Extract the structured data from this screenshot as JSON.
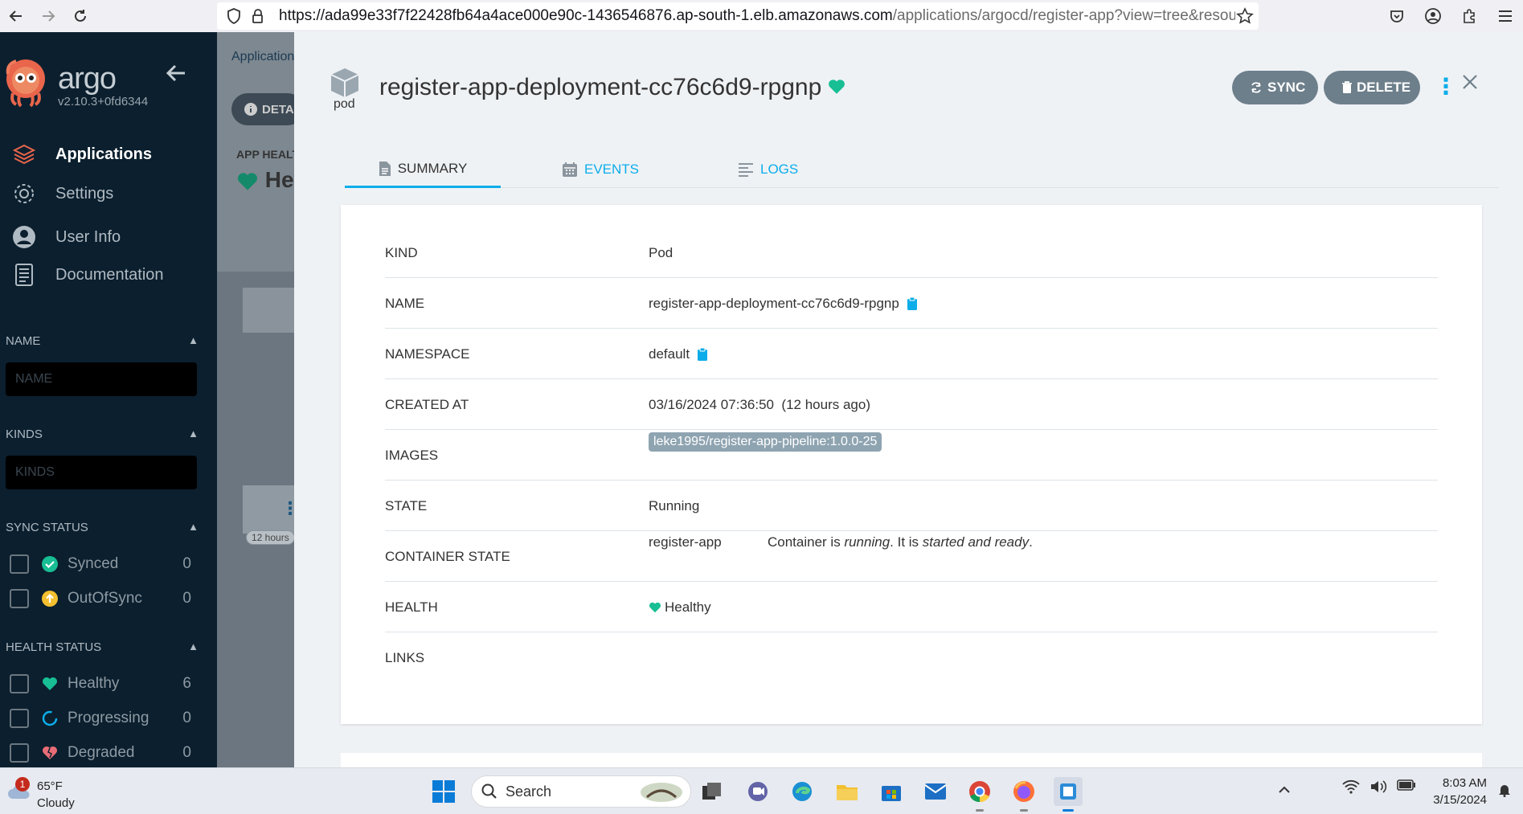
{
  "browser": {
    "url_main": "https://ada99e33f7f22428fb64a4ace000e90c-1436546876.ap-south-1.elb.amazonaws.com",
    "url_path": "/applications/argocd/register-app?view=tree&resource=&condit"
  },
  "sidebar": {
    "logo_name": "argo",
    "version": "v2.10.3+0fd6344",
    "nav": [
      {
        "label": "Applications",
        "icon": "layers-icon"
      },
      {
        "label": "Settings",
        "icon": "gear-icon"
      },
      {
        "label": "User Info",
        "icon": "user-icon"
      },
      {
        "label": "Documentation",
        "icon": "book-icon"
      }
    ],
    "name_filter": {
      "title": "NAME",
      "placeholder": "NAME"
    },
    "kinds_filter": {
      "title": "KINDS",
      "placeholder": "KINDS"
    },
    "sync_status": {
      "title": "SYNC STATUS",
      "items": [
        {
          "label": "Synced",
          "count": "0",
          "color": "#18be94"
        },
        {
          "label": "OutOfSync",
          "count": "0",
          "color": "#f4c030"
        }
      ]
    },
    "health_status": {
      "title": "HEALTH STATUS",
      "items": [
        {
          "label": "Healthy",
          "count": "6",
          "color": "#18be94"
        },
        {
          "label": "Progressing",
          "count": "0",
          "color": "#0dadea"
        },
        {
          "label": "Degraded",
          "count": "0",
          "color": "#e96d76"
        }
      ]
    }
  },
  "background": {
    "breadcrumb": "Applications",
    "details_btn": "DETA",
    "app_health": "APP HEALTH",
    "health_value": "He",
    "time_badge": "12 hours"
  },
  "panel": {
    "kind_label": "pod",
    "title": "register-app-deployment-cc76c6d9-rpgnp",
    "sync_btn": "SYNC",
    "delete_btn": "DELETE",
    "tabs": [
      {
        "label": "SUMMARY"
      },
      {
        "label": "EVENTS"
      },
      {
        "label": "LOGS"
      }
    ],
    "summary": {
      "kind": {
        "key": "KIND",
        "value": "Pod"
      },
      "name": {
        "key": "NAME",
        "value": "register-app-deployment-cc76c6d9-rpgnp"
      },
      "namespace": {
        "key": "NAMESPACE",
        "value": "default"
      },
      "created": {
        "key": "CREATED AT",
        "value": "03/16/2024 07:36:50  (12 hours ago)"
      },
      "images": {
        "key": "IMAGES",
        "value": "leke1995/register-app-pipeline:1.0.0-25"
      },
      "state": {
        "key": "STATE",
        "value": "Running"
      },
      "container_state": {
        "key": "CONTAINER STATE",
        "container": "register-app",
        "msg_prefix": "Container is ",
        "msg_running": "running",
        "msg_mid": ". It is ",
        "msg_ready": "started and ready",
        "msg_end": "."
      },
      "health": {
        "key": "HEALTH",
        "value": "Healthy"
      },
      "links": {
        "key": "LINKS",
        "value": ""
      }
    }
  },
  "taskbar": {
    "weather_temp": "65°F",
    "weather_desc": "Cloudy",
    "weather_badge": "1",
    "search_label": "Search",
    "time": "8:03 AM",
    "date": "3/15/2024"
  },
  "colors": {
    "accent": "#0dadea",
    "healthy": "#18be94",
    "sidebar_bg": "#0b1f2e"
  }
}
